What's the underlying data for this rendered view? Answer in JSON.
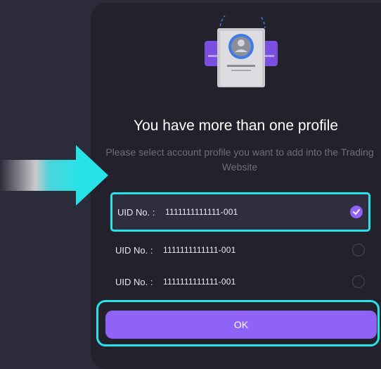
{
  "dialog": {
    "title": "You have more than one profile",
    "subtitle": "Please select account profile you want to add into the Trading Website",
    "profiles": [
      {
        "label": "UID No. :",
        "value": "1111111111111-001",
        "selected": true
      },
      {
        "label": "UID No. :",
        "value": "1111111111111-001",
        "selected": false
      },
      {
        "label": "UID No. :",
        "value": "1111111111111-001",
        "selected": false
      }
    ],
    "ok_label": "OK"
  },
  "colors": {
    "accent": "#8f63f5",
    "highlight": "#27e3e8",
    "background": "#2c2b3a",
    "dialog_bg": "#23222c"
  },
  "icons": {
    "illustration": "profile-cards-icon",
    "pointer": "arrow-right-icon",
    "check": "check-icon"
  }
}
